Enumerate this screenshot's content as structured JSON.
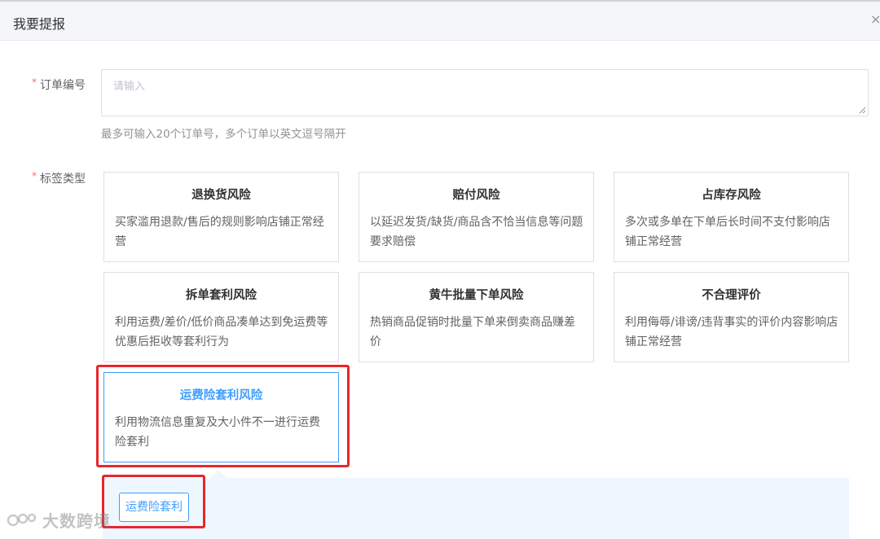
{
  "dialog": {
    "title": "我要提报",
    "close_glyph": "×"
  },
  "form": {
    "order_no": {
      "required_mark": "*",
      "label": "订单编号",
      "placeholder": "请输入",
      "hint": "最多可输入20个订单号，多个订单以英文逗号隔开"
    },
    "tag_type": {
      "required_mark": "*",
      "label": "标签类型",
      "options": [
        {
          "title": "退换货风险",
          "desc": "买家滥用退款/售后的规则影响店铺正常经营"
        },
        {
          "title": "赔付风险",
          "desc": "以延迟发货/缺货/商品含不恰当信息等问题要求赔偿"
        },
        {
          "title": "占库存风险",
          "desc": "多次或多单在下单后长时间不支付影响店铺正常经营"
        },
        {
          "title": "拆单套利风险",
          "desc": "利用运费/差价/低价商品凑单达到免运费等优惠后拒收等套利行为"
        },
        {
          "title": "黄牛批量下单风险",
          "desc": "热销商品促销时批量下单来倒卖商品赚差价"
        },
        {
          "title": "不合理评价",
          "desc": "利用侮辱/诽谤/违背事实的评价内容影响店铺正常经营"
        },
        {
          "title": "运费险套利风险",
          "desc": "利用物流信息重复及大小件不一进行运费险套利"
        }
      ],
      "selected_index": 6,
      "sub_options": [
        "运费险套利"
      ]
    }
  },
  "watermark": "大数跨境",
  "colors": {
    "accent": "#409eff",
    "required": "#f56c6c",
    "highlight": "#e8262a"
  }
}
